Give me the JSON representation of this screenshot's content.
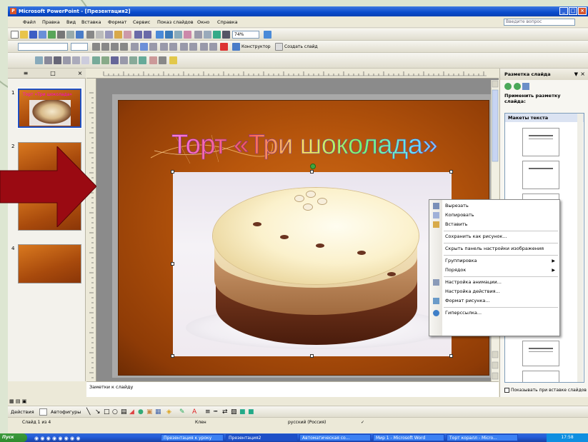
{
  "window": {
    "title": "Microsoft PowerPoint - [Презентация2]",
    "app_icon": "powerpoint-icon"
  },
  "menu": {
    "items": [
      "Файл",
      "Правка",
      "Вид",
      "Вставка",
      "Формат",
      "Сервис",
      "Показ слайдов",
      "Окно",
      "Справка"
    ],
    "help_placeholder": "Введите вопрос"
  },
  "toolbar": {
    "zoom": "74%",
    "designer_label": "Конструктор",
    "new_slide_label": "Создать слайд"
  },
  "slides": {
    "numbers": [
      "1",
      "2",
      "3",
      "4"
    ],
    "thumb1_title": "Торт «Три шоколада»"
  },
  "slide": {
    "title": "Торт «Три шоколада»"
  },
  "context_menu": {
    "items": [
      {
        "label": "Вырезать",
        "icon": "scissors-icon"
      },
      {
        "label": "Копировать",
        "icon": "copy-icon"
      },
      {
        "label": "Вставить",
        "icon": "paste-icon"
      },
      {
        "label": "Сохранить как рисунок...",
        "icon": ""
      },
      {
        "label": "Скрыть панель настройки изображения",
        "icon": ""
      },
      {
        "label": "Группировка",
        "icon": "",
        "submenu": true
      },
      {
        "label": "Порядок",
        "icon": "",
        "submenu": true
      },
      {
        "label": "Настройка анимации...",
        "icon": "animation-icon"
      },
      {
        "label": "Настройка действия...",
        "icon": ""
      },
      {
        "label": "Формат рисунка...",
        "icon": "format-picture-icon"
      },
      {
        "label": "Гиперссылка...",
        "icon": "hyperlink-icon"
      }
    ]
  },
  "notes": {
    "placeholder": "Заметки к слайду"
  },
  "taskpane": {
    "title": "Разметка слайда",
    "apply_label": "Применить разметку слайда:",
    "section_header": "Макеты текста",
    "show_on_insert": "Показывать при вставке слайдов"
  },
  "drawbar": {
    "actions_label": "Действия",
    "autoshapes_label": "Автофигуры"
  },
  "status": {
    "slide_info": "Слайд 1 из 4",
    "design": "Клен",
    "language": "русский (Россия)"
  },
  "taskbar": {
    "start": "Пуск",
    "tasks": [
      "Презентация к уроку",
      "Презентация2",
      "Автоматическая со...",
      "Мир 1 - Microsoft Word",
      "Торт коралл - Micro..."
    ],
    "clock": "17:58"
  }
}
